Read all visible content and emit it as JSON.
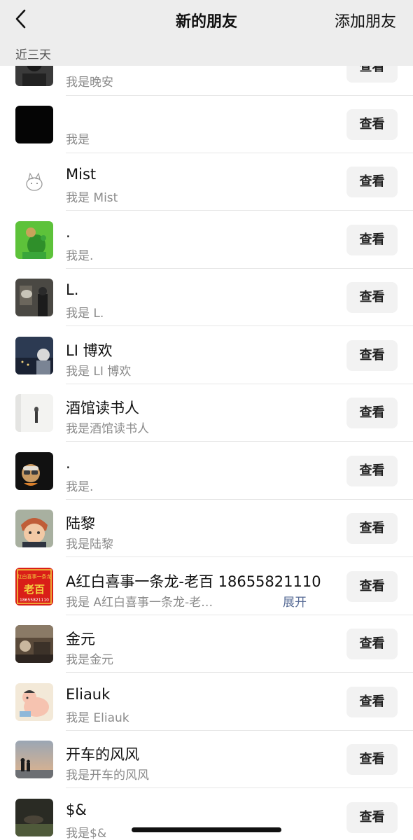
{
  "nav": {
    "title": "新的朋友",
    "action": "添加朋友",
    "back_icon": "chevron-left-icon"
  },
  "section_label": "近三天",
  "view_label": "查看",
  "expand_label": "展开",
  "colors": {
    "nav_bg": "#ededed",
    "button_bg": "#f2f2f2",
    "secondary_text": "#8b8b8b",
    "link": "#576b95"
  },
  "friends": [
    {
      "name": "",
      "message": "我是晚安",
      "avatar": "dark-portrait-avatar"
    },
    {
      "name": "",
      "message": "我是",
      "avatar": "black-avatar"
    },
    {
      "name": "Mist",
      "message": "我是 Mist",
      "avatar": "cat-sketch-avatar"
    },
    {
      "name": ".",
      "message": "我是.",
      "avatar": "green-dinosaur-avatar"
    },
    {
      "name": "L.",
      "message": "我是 L.",
      "avatar": "dark-room-avatar"
    },
    {
      "name": "LI 博欢",
      "message": "我是 LI 博欢",
      "avatar": "night-city-avatar"
    },
    {
      "name": "酒馆读书人",
      "message": "我是酒馆读书人",
      "avatar": "white-figure-avatar"
    },
    {
      "name": ".",
      "message": "我是.",
      "avatar": "monkey-sunglasses-avatar"
    },
    {
      "name": "陆黎",
      "message": "我是陆黎",
      "avatar": "anime-boy-avatar"
    },
    {
      "name": "A红白喜事一条龙-老百 18655821110",
      "message": "我是 A红白喜事一条龙-老…",
      "avatar": "red-banner-avatar",
      "expandable": true
    },
    {
      "name": "金元",
      "message": "我是金元",
      "avatar": "restaurant-avatar"
    },
    {
      "name": "Eliauk",
      "message": "我是 Eliauk",
      "avatar": "cartoon-baby-avatar"
    },
    {
      "name": "开车的风风",
      "message": "我是开车的风风",
      "avatar": "sunset-silhouette-avatar"
    },
    {
      "name": "$&",
      "message": "我是$&",
      "avatar": "dark-outdoor-avatar"
    }
  ],
  "red_avatar_text": {
    "top": "红白喜事一条龙",
    "middle": "老百",
    "bottom": "18655821110"
  }
}
